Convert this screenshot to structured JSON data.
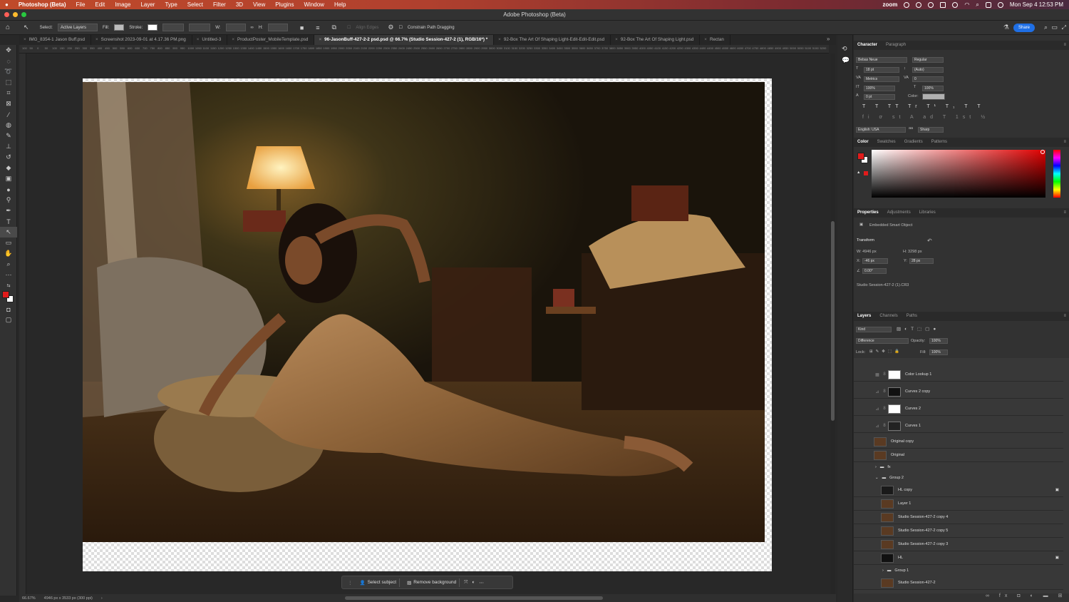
{
  "menubar": {
    "apple": "",
    "app": "Photoshop (Beta)",
    "items": [
      "File",
      "Edit",
      "Image",
      "Layer",
      "Type",
      "Select",
      "Filter",
      "3D",
      "View",
      "Plugins",
      "Window",
      "Help"
    ],
    "zoom": "zoom",
    "datetime": "Mon Sep 4  12:53 PM"
  },
  "title": "Adobe Photoshop (Beta)",
  "options": {
    "select_label": "Select:",
    "select_value": "Active Layers",
    "fill_label": "Fill:",
    "stroke_label": "Stroke:",
    "w_label": "W:",
    "h_label": "H:",
    "align_edges": "Align Edges",
    "constrain": "Constrain Path Dragging",
    "share": "Share"
  },
  "tabs": [
    "IMG_8354-1 Jason Buff.psd",
    "Screenshot 2023-09-01 at 4.17.36 PM.png",
    "Untitled-3",
    "ProductPoster_MobileTemplate.psd",
    "96-JasonBuff-427-2-2 psd.psd @ 66.7% (Studio Session-427-2 (1), RGB/16*) *",
    "92-Box The Art Of Shaping Light-Edit-Edit-Edit.psd",
    "92-Box The Art Of Shaping Light.psd",
    "Rectan"
  ],
  "ruler_ticks": [
    "100",
    "50",
    "0",
    "50",
    "100",
    "150",
    "200",
    "250",
    "300",
    "350",
    "400",
    "450",
    "500",
    "550",
    "600",
    "650",
    "700",
    "750",
    "800",
    "850",
    "900",
    "950",
    "1000",
    "1050",
    "1100",
    "1150",
    "1200",
    "1250",
    "1300",
    "1350",
    "1400",
    "1450",
    "1500",
    "1550",
    "1600",
    "1650",
    "1700",
    "1750",
    "1800",
    "1850",
    "1900",
    "1950",
    "2000",
    "2050",
    "2100",
    "2150",
    "2200",
    "2250",
    "2300",
    "2350",
    "2400",
    "2450",
    "2500",
    "2550",
    "2600",
    "2650",
    "2700",
    "2750",
    "2800",
    "2850",
    "2900",
    "2950",
    "3000",
    "3050",
    "3100",
    "3150",
    "3200",
    "3250",
    "3300",
    "3350",
    "3400",
    "3450",
    "3500",
    "3550",
    "3600",
    "3650",
    "3700",
    "3750",
    "3800",
    "3850",
    "3900",
    "3950",
    "4000",
    "4050",
    "4100",
    "4150",
    "4200",
    "4250",
    "4300",
    "4350",
    "4400",
    "4450",
    "4500",
    "4550",
    "4600",
    "4650",
    "4700",
    "4750",
    "4800",
    "4850",
    "4900",
    "4950",
    "5000",
    "5050",
    "5100",
    "5150",
    "5200"
  ],
  "contextual": {
    "select_subject": "Select subject",
    "remove_background": "Remove background"
  },
  "status": {
    "zoom": "66.67%",
    "size": "4946 px x 3533 px (300 ppi)"
  },
  "character": {
    "tab1": "Character",
    "tab2": "Paragraph",
    "font": "Bebas Neue",
    "style": "Regular",
    "size": "18 pt",
    "leading": "(Auto)",
    "kerning": "Metrics",
    "tracking": "0",
    "vscale": "100%",
    "hscale": "100%",
    "baseline": "0 pt",
    "color_label": "Color:",
    "language": "English: USA",
    "aa": "Sharp",
    "aa_label": "aa"
  },
  "colorpanel": {
    "tabs": [
      "Color",
      "Swatches",
      "Gradients",
      "Patterns"
    ],
    "fg": "#e11b1b"
  },
  "properties": {
    "tabs": [
      "Properties",
      "Adjustments",
      "Libraries"
    ],
    "type": "Embedded Smart Object",
    "transform": "Transform",
    "w": "W: 4946 px",
    "h": "H: 3298 px",
    "x_label": "X:",
    "x": "-46 px",
    "y_label": "Y:",
    "y": "28 px",
    "angle": "0.00°",
    "file": "Studio Session-427-2 (1).CR3"
  },
  "layers": {
    "tabs": [
      "Layers",
      "Channels",
      "Paths"
    ],
    "kind": "Kind",
    "blend": "Difference",
    "opacity_label": "Opacity:",
    "opacity": "100%",
    "lock_label": "Lock:",
    "fill_label": "Fill:",
    "fill": "100%",
    "items": [
      {
        "name": "Color Lookup 1"
      },
      {
        "name": "Curves 2 copy"
      },
      {
        "name": "Curves 2"
      },
      {
        "name": "Curves 1"
      },
      {
        "name": "Original copy"
      },
      {
        "name": "Original"
      },
      {
        "name": "fx"
      },
      {
        "name": "Group 2"
      },
      {
        "name": "HL copy"
      },
      {
        "name": "Layer 1"
      },
      {
        "name": "Studio Session-427-2 copy 4"
      },
      {
        "name": "Studio Session-427-2 copy 5"
      },
      {
        "name": "Studio Session-427-2 copy 3"
      },
      {
        "name": "HL"
      },
      {
        "name": "Group 1"
      },
      {
        "name": "Studio Session-427-2"
      }
    ]
  }
}
